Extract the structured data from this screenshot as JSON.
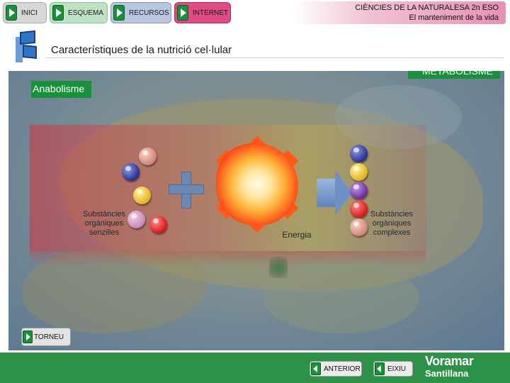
{
  "nav": {
    "inici": "INICI",
    "esquema": "ESQUEMA",
    "recursos": "RECURSOS",
    "internet": "INTERNET"
  },
  "header": {
    "course": "CIÈNCIES DE LA NATURALESA 2n ESO",
    "unit": "El manteniment de la vida"
  },
  "page": {
    "title": "Característiques de la nutrició cel·lular"
  },
  "panel": {
    "section_tag": "METABOLISME",
    "subsection_tag": "Anabolisme",
    "label_simple": "Substàncies orgàniques senzilles",
    "label_energy": "Energia",
    "label_complex": "Substàncies orgàniques complexes"
  },
  "buttons": {
    "back": "TORNEU",
    "previous": "ANTERIOR",
    "exit": "EIXIU"
  },
  "brand": {
    "name": "Voramar",
    "publisher": "Santillana"
  },
  "molecules": {
    "simple": [
      "pink",
      "navy",
      "yellow",
      "lilac",
      "red"
    ],
    "complex": [
      "navy",
      "yellow",
      "purple",
      "red",
      "pink"
    ]
  },
  "colors": {
    "accent_green": "#1a8f3c",
    "footer_green": "#2d9248",
    "internet_pink": "#e04a85"
  }
}
